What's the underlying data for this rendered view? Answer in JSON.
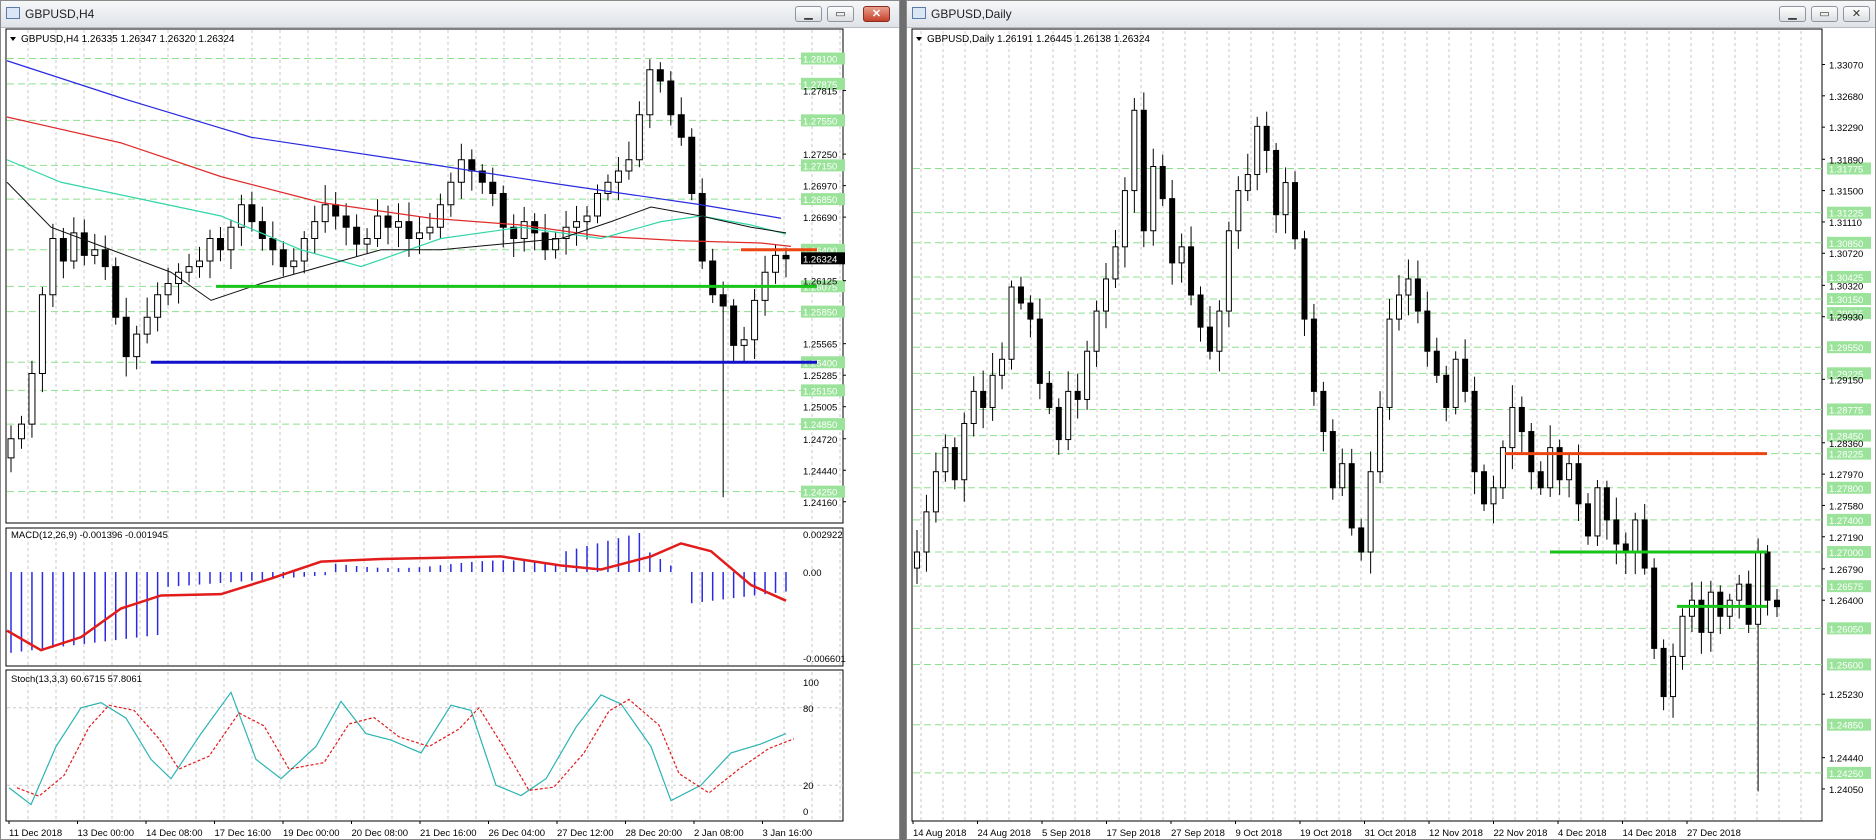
{
  "left_window": {
    "title": "GBPUSD,H4",
    "header": "GBPUSD,H4  1.26335 1.26347 1.26320 1.26324",
    "macd_label": "MACD(12,26,9) -0.001396 -0.001945",
    "stoch_label": "Stoch(13,3,3) 60.6715 57.8061",
    "price_scale_dark": [
      "1.27815",
      "1.27250",
      "1.26970",
      "1.26690",
      "1.26125",
      "1.25565",
      "1.25285",
      "1.25005",
      "1.24720",
      "1.24440",
      "1.24160"
    ],
    "price_scale_green": [
      "1.28100",
      "1.27875",
      "1.27550",
      "1.27150",
      "1.26850",
      "1.26400",
      "1.26075",
      "1.25850",
      "1.25400",
      "1.25150",
      "1.24850",
      "1.24250"
    ],
    "current_price": "1.26324",
    "macd_scale": [
      "0.002922",
      "0.00",
      "-0.006601"
    ],
    "stoch_scale": [
      "100",
      "80",
      "20",
      "0"
    ],
    "time_axis": [
      "11 Dec 2018",
      "13 Dec 00:00",
      "14 Dec 08:00",
      "17 Dec 16:00",
      "19 Dec 00:00",
      "20 Dec 08:00",
      "21 Dec 16:00",
      "26 Dec 04:00",
      "27 Dec 12:00",
      "28 Dec 20:00",
      "2 Jan 08:00",
      "3 Jan 16:00"
    ]
  },
  "right_window": {
    "title": "GBPUSD,Daily",
    "header": "GBPUSD,Daily  1.26191 1.26445 1.26138 1.26324",
    "price_scale_dark": [
      "1.33070",
      "1.32680",
      "1.32290",
      "1.31890",
      "1.31500",
      "1.31110",
      "1.30720",
      "1.30320",
      "1.29930",
      "1.29150",
      "1.28360",
      "1.27970",
      "1.27580",
      "1.27190",
      "1.26790",
      "1.26400",
      "1.25230",
      "1.24440",
      "1.24050"
    ],
    "price_scale_green": [
      "1.31775",
      "1.31225",
      "1.30850",
      "1.30425",
      "1.30150",
      "1.29975",
      "1.29550",
      "1.29225",
      "1.28775",
      "1.28450",
      "1.28225",
      "1.27800",
      "1.27400",
      "1.27000",
      "1.26575",
      "1.26050",
      "1.25600",
      "1.24850",
      "1.24250"
    ],
    "time_axis": [
      "14 Aug 2018",
      "24 Aug 2018",
      "5 Sep 2018",
      "17 Sep 2018",
      "27 Sep 2018",
      "9 Oct 2018",
      "19 Oct 2018",
      "31 Oct 2018",
      "12 Nov 2018",
      "22 Nov 2018",
      "4 Dec 2018",
      "14 Dec 2018",
      "27 Dec 2018"
    ]
  },
  "colors": {
    "ma_blue": "#2a2ae0",
    "ma_red": "#e02a2a",
    "ma_cyan": "#33d6a8",
    "ma_black": "#111111",
    "support_green": "#19c419",
    "support_blue": "#1111cc",
    "resistance_orange": "#ee4411",
    "grid_green": "#8ee08e"
  },
  "icons": [
    "chart-window-icon",
    "minimize-icon",
    "maximize-icon",
    "close-icon",
    "dropdown-triangle-icon"
  ]
}
